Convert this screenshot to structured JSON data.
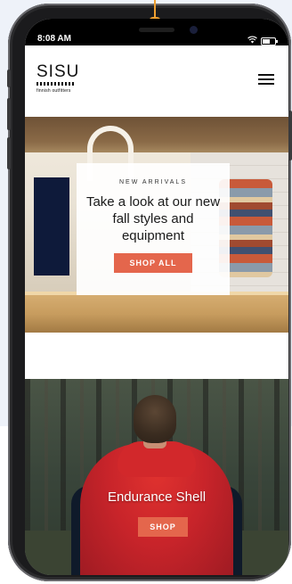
{
  "status_bar": {
    "time": "8:08 AM"
  },
  "header": {
    "logo": "SISU",
    "tagline": "finnish outfitters"
  },
  "hero": {
    "eyebrow": "NEW ARRIVALS",
    "headline": "Take a look at our new fall styles and equipment",
    "cta": "SHOP ALL"
  },
  "product": {
    "title": "Endurance Shell",
    "cta": "SHOP"
  },
  "colors": {
    "accent": "#e4664c",
    "annotation_arrow": "#f0a030",
    "backdrop": "#eef2f9"
  },
  "icons": [
    "wifi-icon",
    "battery-icon",
    "hamburger-menu-icon"
  ]
}
